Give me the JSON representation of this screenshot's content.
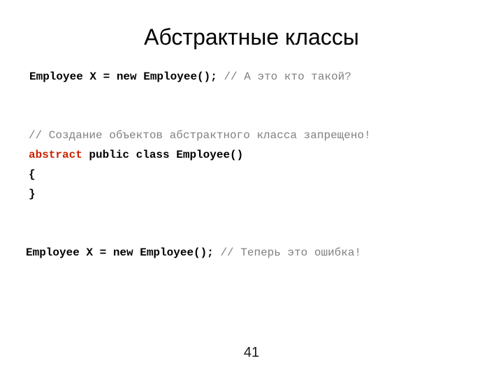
{
  "slide": {
    "title": "Абстрактные классы",
    "page_number": "41",
    "colors": {
      "background": "#ffffff",
      "text": "#000000",
      "comment": "#808080",
      "keyword": "#cc2200"
    },
    "code_lines": [
      {
        "id": "line-instantiate-first",
        "indent": "a",
        "segments": [
          {
            "kind": "code",
            "text": "Employee X = new Employee(); "
          },
          {
            "kind": "comment",
            "text": "// А это кто такой?"
          }
        ]
      },
      {
        "id": "line-blank-1",
        "indent": "a",
        "segments": [
          {
            "kind": "code",
            "text": " "
          }
        ]
      },
      {
        "id": "line-blank-2",
        "indent": "a",
        "segments": [
          {
            "kind": "code",
            "text": " "
          }
        ]
      },
      {
        "id": "line-comment-forbidden",
        "indent": "b",
        "segments": [
          {
            "kind": "comment",
            "text": "// Создание объектов абстрактного класса запрещено!"
          }
        ]
      },
      {
        "id": "line-class-declaration",
        "indent": "b",
        "segments": [
          {
            "kind": "keyword",
            "text": "abstract"
          },
          {
            "kind": "code",
            "text": " public class Employee()"
          }
        ]
      },
      {
        "id": "line-open-brace",
        "indent": "b",
        "segments": [
          {
            "kind": "code",
            "text": "{"
          }
        ]
      },
      {
        "id": "line-close-brace",
        "indent": "b",
        "segments": [
          {
            "kind": "code",
            "text": "}"
          }
        ]
      },
      {
        "id": "line-blank-3",
        "indent": "b",
        "segments": [
          {
            "kind": "code",
            "text": " "
          }
        ]
      },
      {
        "id": "line-blank-4",
        "indent": "b",
        "segments": [
          {
            "kind": "code",
            "text": " "
          }
        ]
      },
      {
        "id": "line-instantiate-second",
        "indent": "c",
        "segments": [
          {
            "kind": "code",
            "text": "Employee X = new Employee(); "
          },
          {
            "kind": "comment",
            "text": "// Теперь это ошибка!"
          }
        ]
      }
    ]
  }
}
